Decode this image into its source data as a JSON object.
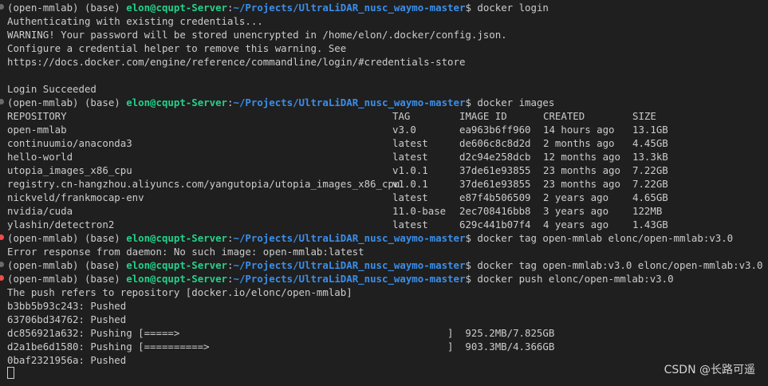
{
  "prompt": {
    "env": "(open-mmlab) (base) ",
    "user": "elon@cqupt-Server",
    "sep": ":",
    "path": "~/Projects/UltraLiDAR_nusc_waymo-master",
    "end": "$ "
  },
  "colors": {
    "background": "#1f1f1f",
    "text": "#cccccc",
    "user": "#23d18b",
    "path": "#3b8eea",
    "error_dot": "#f14c4c"
  },
  "lines": [
    {
      "type": "prompt",
      "cmd": "docker login",
      "dot": "ok"
    },
    {
      "type": "text",
      "text": "Authenticating with existing credentials..."
    },
    {
      "type": "text",
      "text": "WARNING! Your password will be stored unencrypted in /home/elon/.docker/config.json."
    },
    {
      "type": "text",
      "text": "Configure a credential helper to remove this warning. See"
    },
    {
      "type": "text",
      "text": "https://docs.docker.com/engine/reference/commandline/login/#credentials-store"
    },
    {
      "type": "text",
      "text": ""
    },
    {
      "type": "text",
      "text": "Login Succeeded"
    },
    {
      "type": "prompt",
      "cmd": "docker images",
      "dot": "ok"
    },
    {
      "type": "row",
      "cells": [
        "REPOSITORY",
        "TAG",
        "IMAGE ID",
        "CREATED",
        "SIZE"
      ]
    },
    {
      "type": "row",
      "cells": [
        "open-mmlab",
        "v3.0",
        "ea963b6ff960",
        "14 hours ago",
        "13.1GB"
      ]
    },
    {
      "type": "row",
      "cells": [
        "continuumio/anaconda3",
        "latest",
        "de606c8c8d2d",
        "2 months ago",
        "4.45GB"
      ]
    },
    {
      "type": "row",
      "cells": [
        "hello-world",
        "latest",
        "d2c94e258dcb",
        "12 months ago",
        "13.3kB"
      ]
    },
    {
      "type": "row",
      "cells": [
        "utopia_images_x86_cpu",
        "v1.0.1",
        "37de61e93855",
        "23 months ago",
        "7.22GB"
      ]
    },
    {
      "type": "row",
      "cells": [
        "registry.cn-hangzhou.aliyuncs.com/yangutopia/utopia_images_x86_cpu",
        "v1.0.1",
        "37de61e93855",
        "23 months ago",
        "7.22GB"
      ]
    },
    {
      "type": "row",
      "cells": [
        "nickveld/frankmocap-env",
        "latest",
        "e87f4b506509",
        "2 years ago",
        "4.65GB"
      ]
    },
    {
      "type": "row",
      "cells": [
        "nvidia/cuda",
        "11.0-base",
        "2ec708416bb8",
        "3 years ago",
        "122MB"
      ]
    },
    {
      "type": "row",
      "cells": [
        "ylashin/detectron2",
        "latest",
        "629c441b07f4",
        "4 years ago",
        "1.43GB"
      ]
    },
    {
      "type": "prompt",
      "cmd": "docker tag open-mmlab elonc/open-mmlab:v3.0",
      "dot": "err"
    },
    {
      "type": "text",
      "text": "Error response from daemon: No such image: open-mmlab:latest"
    },
    {
      "type": "prompt",
      "cmd": "docker tag open-mmlab:v3.0 elonc/open-mmlab:v3.0",
      "dot": "ok"
    },
    {
      "type": "prompt",
      "cmd": "docker push elonc/open-mmlab:v3.0",
      "dot": "err"
    },
    {
      "type": "text",
      "text": "The push refers to repository [docker.io/elonc/open-mmlab]"
    },
    {
      "type": "text",
      "text": "b3bb5b93c243: Pushed"
    },
    {
      "type": "text",
      "text": "63706bd34762: Pushed"
    },
    {
      "type": "progress",
      "text": "dc856921a632: Pushing [=====>                                             ]  925.2MB/7.825GB",
      "fraction": 0.118
    },
    {
      "type": "progress",
      "text": "d2a1be6d1580: Pushing [==========>                                        ]  903.3MB/4.366GB",
      "fraction": 0.207
    },
    {
      "type": "text",
      "text": "0baf2321956a: Pushed"
    },
    {
      "type": "cursor"
    }
  ],
  "watermark": "CSDN @长路可遥"
}
